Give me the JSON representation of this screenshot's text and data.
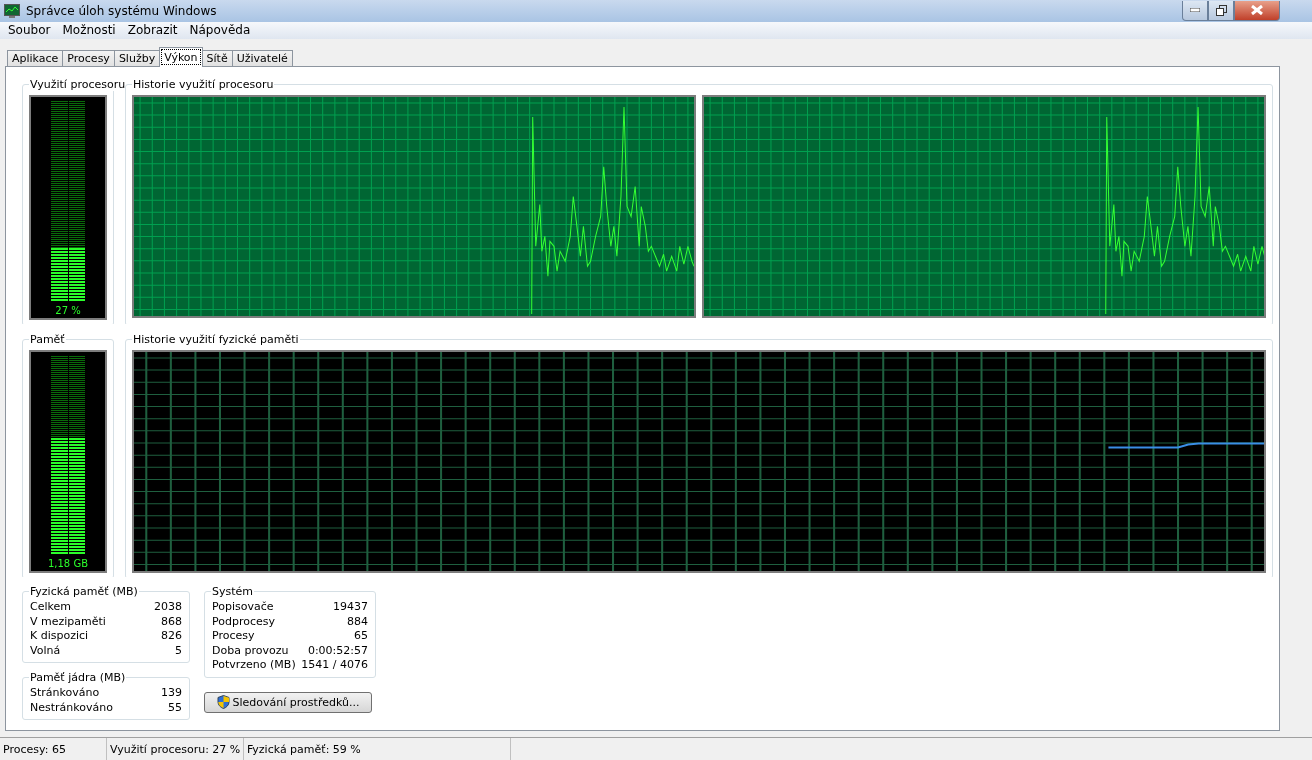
{
  "window": {
    "title": "Správce úloh systému Windows"
  },
  "menu": [
    "Soubor",
    "Možnosti",
    "Zobrazit",
    "Nápověda"
  ],
  "tabs": [
    {
      "label": "Aplikace",
      "selected": false
    },
    {
      "label": "Procesy",
      "selected": false
    },
    {
      "label": "Služby",
      "selected": false
    },
    {
      "label": "Výkon",
      "selected": true
    },
    {
      "label": "Sítě",
      "selected": false
    },
    {
      "label": "Uživatelé",
      "selected": false
    }
  ],
  "cpu_meter": {
    "title": "Využití procesoru",
    "level": 0.27,
    "reading": "27 %"
  },
  "cpu_history": {
    "title": "Historie využití procesoru"
  },
  "memory_meter": {
    "title": "Paměť",
    "level": 0.59,
    "reading": "1,18 GB"
  },
  "memory_history": {
    "title": "Historie využití fyzické paměti"
  },
  "physical_memory": {
    "title": "Fyzická paměť (MB)",
    "rows": [
      {
        "label": "Celkem",
        "value": "2038"
      },
      {
        "label": "V mezipaměti",
        "value": "868"
      },
      {
        "label": "K dispozici",
        "value": "826"
      },
      {
        "label": "Volná",
        "value": "5"
      }
    ]
  },
  "kernel_memory": {
    "title": "Paměť jádra (MB)",
    "rows": [
      {
        "label": "Stránkováno",
        "value": "139"
      },
      {
        "label": "Nestránkováno",
        "value": "55"
      }
    ]
  },
  "system": {
    "title": "Systém",
    "rows": [
      {
        "label": "Popisovače",
        "value": "19437"
      },
      {
        "label": "Podprocesy",
        "value": "884"
      },
      {
        "label": "Procesy",
        "value": "65"
      },
      {
        "label": "Doba provozu",
        "value": "0:00:52:57"
      },
      {
        "label": "Potvrzeno (MB)",
        "value": "1541 / 4076"
      }
    ]
  },
  "resource_button": "Sledování prostředků...",
  "status_bar": [
    "Procesy: 65",
    "Využití procesoru: 27 %",
    "Fyzická paměť: 59 %"
  ]
}
